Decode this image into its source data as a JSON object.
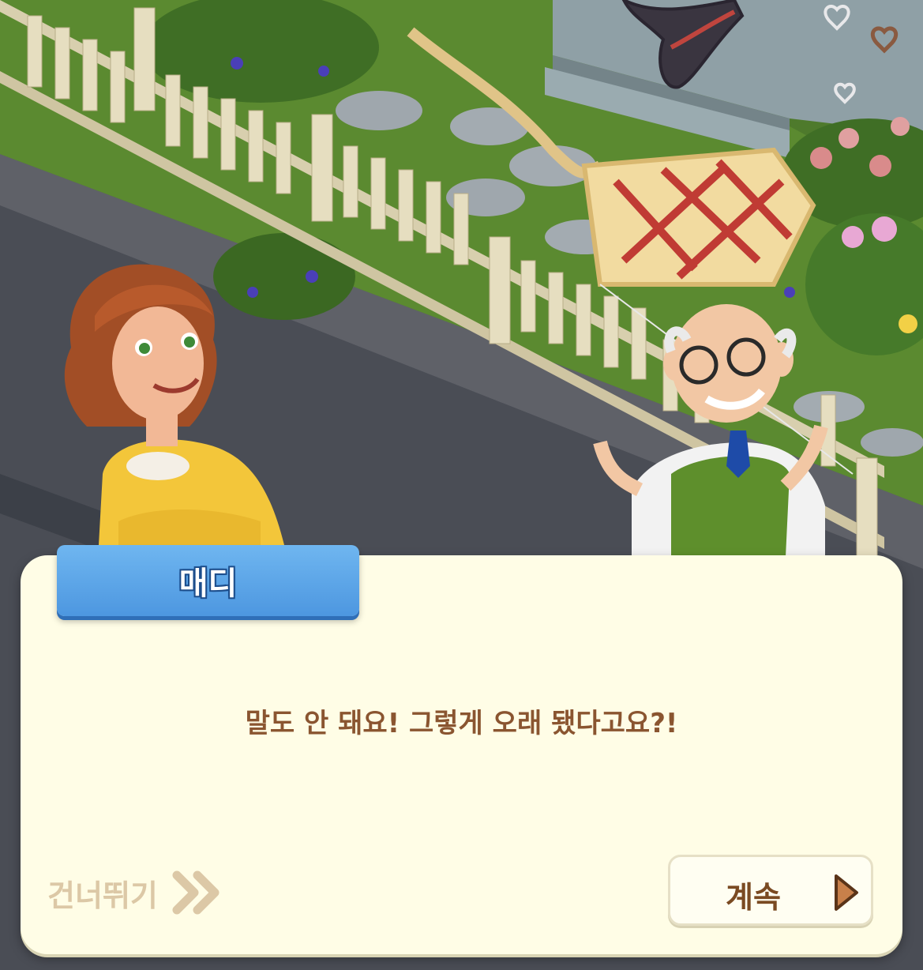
{
  "dialog": {
    "speaker_name": "매디",
    "text": "말도 안 돼요! 그렇게 오래 됐다고요?!",
    "skip_label": "건너뛰기",
    "continue_label": "계속"
  },
  "icons": {
    "skip": "double-chevron-right-icon",
    "continue": "play-triangle-icon"
  },
  "colors": {
    "dialog_bg": "#fffde6",
    "nameplate": "#5aa6ea",
    "text": "#8a5530",
    "skip_text": "#dcc8a6",
    "continue_arrow": "#c8804a"
  }
}
